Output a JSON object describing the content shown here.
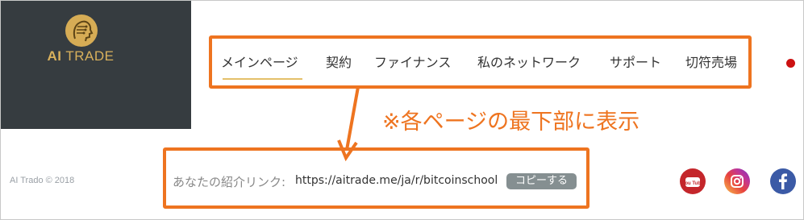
{
  "header": {
    "logo": {
      "brand_bold": "AI",
      "brand_rest": "TRADE"
    },
    "nav": [
      {
        "label": "メインページ",
        "active": true
      },
      {
        "label": "契約"
      },
      {
        "label": "ファイナンス"
      },
      {
        "label": "私のネットワーク"
      },
      {
        "label": "サポート"
      },
      {
        "label": "切符売場"
      }
    ]
  },
  "annotation": {
    "text": "※各ページの最下部に表示"
  },
  "footer": {
    "copyright": "AI Trado © 2018",
    "referral_label": "あなたの紹介リンク:",
    "referral_url": "https://aitrade.me/ja/r/bitcoinschool",
    "copy_button": "コピーする",
    "social": [
      {
        "icon": "youtube-icon",
        "text": "You Tube"
      },
      {
        "icon": "instagram-icon"
      },
      {
        "icon": "facebook-icon"
      }
    ]
  },
  "colors": {
    "logo_panel": "#363c40",
    "gold": "#d6ac55",
    "highlight_orange": "#ee7420",
    "nav_underline": "#e4c06a",
    "copy_button": "#858f91"
  }
}
